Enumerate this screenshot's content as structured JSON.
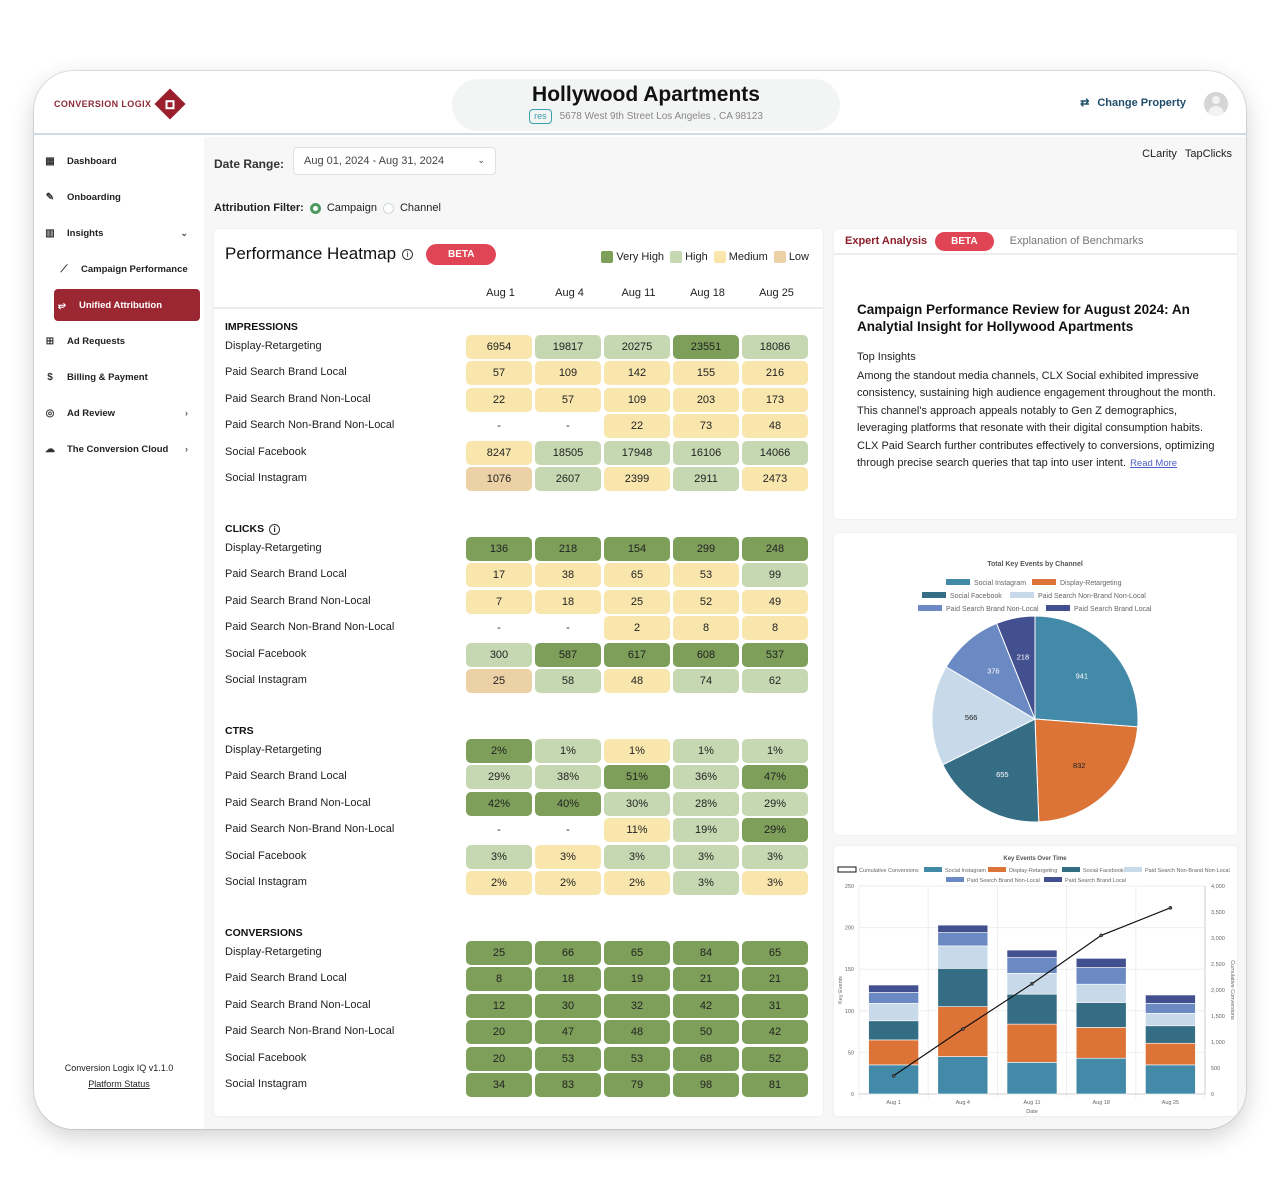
{
  "brand": {
    "logo_text": "CONVERSION LOGIX"
  },
  "property": {
    "title": "Hollywood Apartments",
    "tag": "res",
    "address": "5678 West 9th Street Los Angeles , CA 98123"
  },
  "header": {
    "change_property": "Change Property"
  },
  "sidebar": {
    "items": [
      {
        "label": "Dashboard",
        "icon": "dashboard-icon"
      },
      {
        "label": "Onboarding",
        "icon": "edit-icon"
      },
      {
        "label": "Insights",
        "icon": "bar-chart-icon"
      },
      {
        "label": "Campaign Performance",
        "icon": "line-chart-icon"
      },
      {
        "label": "Unified Attribution",
        "icon": "attribution-icon"
      },
      {
        "label": "Ad Requests",
        "icon": "message-plus-icon"
      },
      {
        "label": "Billing & Payment",
        "icon": "dollar-icon"
      },
      {
        "label": "Ad Review",
        "icon": "review-icon"
      },
      {
        "label": "The Conversion Cloud",
        "icon": "cloud-icon"
      }
    ],
    "version": "Conversion Logix IQ v1.1.0",
    "platform_status": "Platform Status"
  },
  "filters": {
    "date_label": "Date Range:",
    "date_value": "Aug 01, 2024 - Aug 31, 2024",
    "attribution_label": "Attribution Filter:",
    "options": [
      "Campaign",
      "Channel"
    ],
    "selected": "Campaign"
  },
  "links": [
    "CLarity",
    "TapClicks"
  ],
  "heatmap": {
    "title": "Performance Heatmap",
    "badge": "BETA",
    "legend": [
      {
        "label": "Very High",
        "color": "#7d9f5a"
      },
      {
        "label": "High",
        "color": "#c5d8b1"
      },
      {
        "label": "Medium",
        "color": "#f8e6ad"
      },
      {
        "label": "Low",
        "color": "#ecd0a6"
      }
    ],
    "columns": [
      "Aug 1",
      "Aug 4",
      "Aug 11",
      "Aug 18",
      "Aug 25"
    ],
    "sections": [
      {
        "title": "IMPRESSIONS",
        "info": false,
        "rows": [
          {
            "label": "Display-Retargeting",
            "values": [
              "6954",
              "19817",
              "20275",
              "23551",
              "18086"
            ],
            "levels": [
              "m",
              "h",
              "h",
              "v",
              "h"
            ]
          },
          {
            "label": "Paid Search Brand Local",
            "values": [
              "57",
              "109",
              "142",
              "155",
              "216"
            ],
            "levels": [
              "m",
              "m",
              "m",
              "m",
              "m"
            ]
          },
          {
            "label": "Paid Search Brand Non-Local",
            "values": [
              "22",
              "57",
              "109",
              "203",
              "173"
            ],
            "levels": [
              "m",
              "m",
              "m",
              "m",
              "m"
            ]
          },
          {
            "label": "Paid Search Non-Brand Non-Local",
            "values": [
              "-",
              "-",
              "22",
              "73",
              "48"
            ],
            "levels": [
              "n",
              "n",
              "m",
              "m",
              "m"
            ]
          },
          {
            "label": "Social Facebook",
            "values": [
              "8247",
              "18505",
              "17948",
              "16106",
              "14066"
            ],
            "levels": [
              "m",
              "h",
              "h",
              "h",
              "h"
            ]
          },
          {
            "label": "Social Instagram",
            "values": [
              "1076",
              "2607",
              "2399",
              "2911",
              "2473"
            ],
            "levels": [
              "l",
              "h",
              "m",
              "h",
              "m"
            ]
          }
        ]
      },
      {
        "title": "CLICKS",
        "info": true,
        "rows": [
          {
            "label": "Display-Retargeting",
            "values": [
              "136",
              "218",
              "154",
              "299",
              "248"
            ],
            "levels": [
              "v",
              "v",
              "v",
              "v",
              "v"
            ]
          },
          {
            "label": "Paid Search Brand Local",
            "values": [
              "17",
              "38",
              "65",
              "53",
              "99"
            ],
            "levels": [
              "m",
              "m",
              "m",
              "m",
              "h"
            ]
          },
          {
            "label": "Paid Search Brand Non-Local",
            "values": [
              "7",
              "18",
              "25",
              "52",
              "49"
            ],
            "levels": [
              "m",
              "m",
              "m",
              "m",
              "m"
            ]
          },
          {
            "label": "Paid Search Non-Brand Non-Local",
            "values": [
              "-",
              "-",
              "2",
              "8",
              "8"
            ],
            "levels": [
              "n",
              "n",
              "m",
              "m",
              "m"
            ]
          },
          {
            "label": "Social Facebook",
            "values": [
              "300",
              "587",
              "617",
              "608",
              "537"
            ],
            "levels": [
              "h",
              "v",
              "v",
              "v",
              "v"
            ]
          },
          {
            "label": "Social Instagram",
            "values": [
              "25",
              "58",
              "48",
              "74",
              "62"
            ],
            "levels": [
              "l",
              "h",
              "m",
              "h",
              "h"
            ]
          }
        ]
      },
      {
        "title": "CTRS",
        "info": false,
        "rows": [
          {
            "label": "Display-Retargeting",
            "values": [
              "2%",
              "1%",
              "1%",
              "1%",
              "1%"
            ],
            "levels": [
              "v",
              "h",
              "m",
              "h",
              "h"
            ]
          },
          {
            "label": "Paid Search Brand Local",
            "values": [
              "29%",
              "38%",
              "51%",
              "36%",
              "47%"
            ],
            "levels": [
              "h",
              "h",
              "v",
              "h",
              "v"
            ]
          },
          {
            "label": "Paid Search Brand Non-Local",
            "values": [
              "42%",
              "40%",
              "30%",
              "28%",
              "29%"
            ],
            "levels": [
              "v",
              "v",
              "h",
              "h",
              "h"
            ]
          },
          {
            "label": "Paid Search Non-Brand Non-Local",
            "values": [
              "-",
              "-",
              "11%",
              "19%",
              "29%"
            ],
            "levels": [
              "n",
              "n",
              "m",
              "h",
              "v"
            ]
          },
          {
            "label": "Social Facebook",
            "values": [
              "3%",
              "3%",
              "3%",
              "3%",
              "3%"
            ],
            "levels": [
              "h",
              "m",
              "h",
              "h",
              "h"
            ]
          },
          {
            "label": "Social Instagram",
            "values": [
              "2%",
              "2%",
              "2%",
              "3%",
              "3%"
            ],
            "levels": [
              "m",
              "m",
              "m",
              "h",
              "m"
            ]
          }
        ]
      },
      {
        "title": "CONVERSIONS",
        "info": false,
        "rows": [
          {
            "label": "Display-Retargeting",
            "values": [
              "25",
              "66",
              "65",
              "84",
              "65"
            ],
            "levels": [
              "v",
              "v",
              "v",
              "v",
              "v"
            ]
          },
          {
            "label": "Paid Search Brand Local",
            "values": [
              "8",
              "18",
              "19",
              "21",
              "21"
            ],
            "levels": [
              "v",
              "v",
              "v",
              "v",
              "v"
            ]
          },
          {
            "label": "Paid Search Brand Non-Local",
            "values": [
              "12",
              "30",
              "32",
              "42",
              "31"
            ],
            "levels": [
              "v",
              "v",
              "v",
              "v",
              "v"
            ]
          },
          {
            "label": "Paid Search Non-Brand Non-Local",
            "values": [
              "20",
              "47",
              "48",
              "50",
              "42"
            ],
            "levels": [
              "v",
              "v",
              "v",
              "v",
              "v"
            ]
          },
          {
            "label": "Social Facebook",
            "values": [
              "20",
              "53",
              "53",
              "68",
              "52"
            ],
            "levels": [
              "v",
              "v",
              "v",
              "v",
              "v"
            ]
          },
          {
            "label": "Social Instagram",
            "values": [
              "34",
              "83",
              "79",
              "98",
              "81"
            ],
            "levels": [
              "v",
              "v",
              "v",
              "v",
              "v"
            ]
          }
        ]
      }
    ]
  },
  "analysis": {
    "tab_active": "Expert Analysis",
    "badge": "BETA",
    "tab_other": "Explanation of Benchmarks",
    "title": "Campaign Performance Review for August 2024: An Analytial Insight for Hollywood Apartments",
    "subheading": "Top Insights",
    "body": "Among the standout media channels, CLX Social exhibited impressive consistency, sustaining high audience engagement throughout the month. This channel's approach appeals notably to Gen Z demographics, leveraging platforms that resonate with their digital consumption habits. CLX Paid Search further contributes effectively to conversions, optimizing through precise search queries that tap into user intent.",
    "read_more": "Read More"
  },
  "chart_data": [
    {
      "type": "pie",
      "title": "Total Key Events by Channel",
      "legend_position": "top",
      "categories": [
        "Social Instagram",
        "Display-Retargeting",
        "Social Facebook",
        "Paid Search Non-Brand Non-Local",
        "Paid Search Brand Non-Local",
        "Paid Search Brand Local"
      ],
      "values": [
        941,
        832,
        655,
        566,
        376,
        218
      ],
      "colors": [
        "#4389a8",
        "#dc7337",
        "#356d85",
        "#c8dae9",
        "#6b8ac4",
        "#43508f"
      ]
    },
    {
      "type": "bar",
      "stacked": true,
      "title": "Key Events Over Time",
      "xlabel": "Date",
      "ylabel": "Key Events",
      "y2label": "Cumulative Conversions",
      "ylim": [
        0,
        250
      ],
      "y2lim": [
        0,
        4000
      ],
      "yticks": [
        0,
        50,
        100,
        150,
        200,
        250
      ],
      "y2ticks": [
        "0",
        "500",
        "1,000",
        "1,500",
        "2,000",
        "2,500",
        "3,000",
        "3,500",
        "4,000"
      ],
      "grid": true,
      "legend_position": "top",
      "categories": [
        "Aug 1",
        "Aug 4",
        "Aug 11",
        "Aug 18",
        "Aug 25"
      ],
      "series": [
        {
          "name": "Social Instagram",
          "color": "#4389a8",
          "values": [
            35,
            45,
            38,
            43,
            35
          ]
        },
        {
          "name": "Display-Retargeting",
          "color": "#dc7337",
          "values": [
            30,
            60,
            46,
            37,
            26
          ]
        },
        {
          "name": "Social Facebook",
          "color": "#356d85",
          "values": [
            23,
            46,
            36,
            30,
            21
          ]
        },
        {
          "name": "Paid Search Non-Brand Non-Local",
          "color": "#c8dae9",
          "values": [
            21,
            27,
            25,
            22,
            15
          ]
        },
        {
          "name": "Paid Search Brand Non-Local",
          "color": "#6b8ac4",
          "values": [
            13,
            16,
            19,
            20,
            12
          ]
        },
        {
          "name": "Paid Search Brand Local",
          "color": "#43508f",
          "values": [
            9,
            9,
            9,
            11,
            10
          ]
        }
      ],
      "line": {
        "name": "Cumulative Conversions",
        "axis": "right",
        "values": [
          350,
          1250,
          2120,
          3050,
          3580
        ]
      }
    }
  ]
}
